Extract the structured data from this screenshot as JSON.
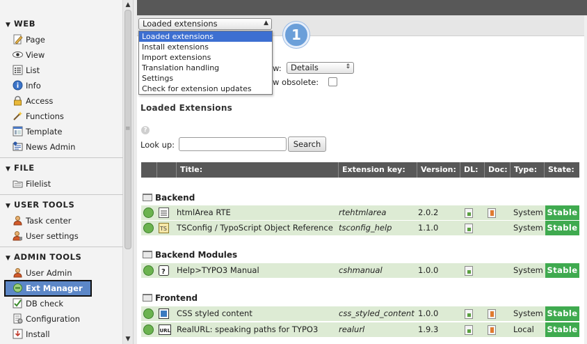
{
  "sidebar": {
    "sections": [
      {
        "title": "WEB",
        "items": [
          {
            "label": "Page",
            "icon": "page-edit-icon"
          },
          {
            "label": "View",
            "icon": "eye-icon"
          },
          {
            "label": "List",
            "icon": "list-icon"
          },
          {
            "label": "Info",
            "icon": "info-icon"
          },
          {
            "label": "Access",
            "icon": "lock-icon"
          },
          {
            "label": "Functions",
            "icon": "wand-icon"
          },
          {
            "label": "Template",
            "icon": "template-icon"
          },
          {
            "label": "News Admin",
            "icon": "news-icon"
          }
        ]
      },
      {
        "title": "FILE",
        "items": [
          {
            "label": "Filelist",
            "icon": "folder-icon"
          }
        ]
      },
      {
        "title": "USER TOOLS",
        "items": [
          {
            "label": "Task center",
            "icon": "user-icon"
          },
          {
            "label": "User settings",
            "icon": "user-settings-icon"
          }
        ]
      },
      {
        "title": "ADMIN TOOLS",
        "items": [
          {
            "label": "User Admin",
            "icon": "user-admin-icon"
          },
          {
            "label": "Ext Manager",
            "icon": "ext-manager-icon"
          },
          {
            "label": "DB check",
            "icon": "db-check-icon"
          },
          {
            "label": "Configuration",
            "icon": "configuration-icon"
          },
          {
            "label": "Install",
            "icon": "install-icon"
          }
        ]
      }
    ]
  },
  "header": {
    "function_select": "Loaded extensions",
    "callout": "1",
    "dropdown_options": [
      "Loaded extensions",
      "Install extensions",
      "Import extensions",
      "Translation handling",
      "Settings",
      "Check for extension updates"
    ]
  },
  "options": {
    "view_label": "w:",
    "view_value": "Details",
    "obsolete_label": "w obsolete:"
  },
  "main": {
    "section_title": "Loaded Extensions",
    "help_glyph": "?",
    "lookup_label": "Look up:",
    "search_button": "Search"
  },
  "table": {
    "headers": [
      "Title:",
      "Extension key:",
      "Version:",
      "DL:",
      "Doc:",
      "Type:",
      "State:"
    ],
    "categories": [
      {
        "name": "Backend",
        "rows": [
          {
            "title": "htmlArea RTE",
            "key": "rtehtmlarea",
            "version": "2.0.2",
            "type": "System",
            "state": "Stable",
            "has_doc": true
          },
          {
            "title": "TSConfig / TypoScript Object Reference",
            "key": "tsconfig_help",
            "version": "1.1.0",
            "type": "System",
            "state": "Stable",
            "has_doc": false
          }
        ]
      },
      {
        "name": "Backend Modules",
        "rows": [
          {
            "title": "Help>TYPO3 Manual",
            "key": "cshmanual",
            "version": "1.0.0",
            "type": "System",
            "state": "Stable",
            "has_doc": false
          }
        ]
      },
      {
        "name": "Frontend",
        "rows": [
          {
            "title": "CSS styled content",
            "key": "css_styled_content",
            "version": "1.0.0",
            "type": "System",
            "state": "Stable",
            "has_doc": true
          },
          {
            "title": "RealURL: speaking paths for TYPO3",
            "key": "realurl",
            "version": "1.9.3",
            "type": "Local",
            "state": "Stable",
            "has_doc": true
          }
        ]
      }
    ]
  },
  "colors": {
    "active_nav": "#5c87c7",
    "header_bar": "#585858",
    "row_bg": "#ddebd4",
    "stable_badge": "#3faa4f",
    "dropdown_selected": "#3d6fd1"
  }
}
